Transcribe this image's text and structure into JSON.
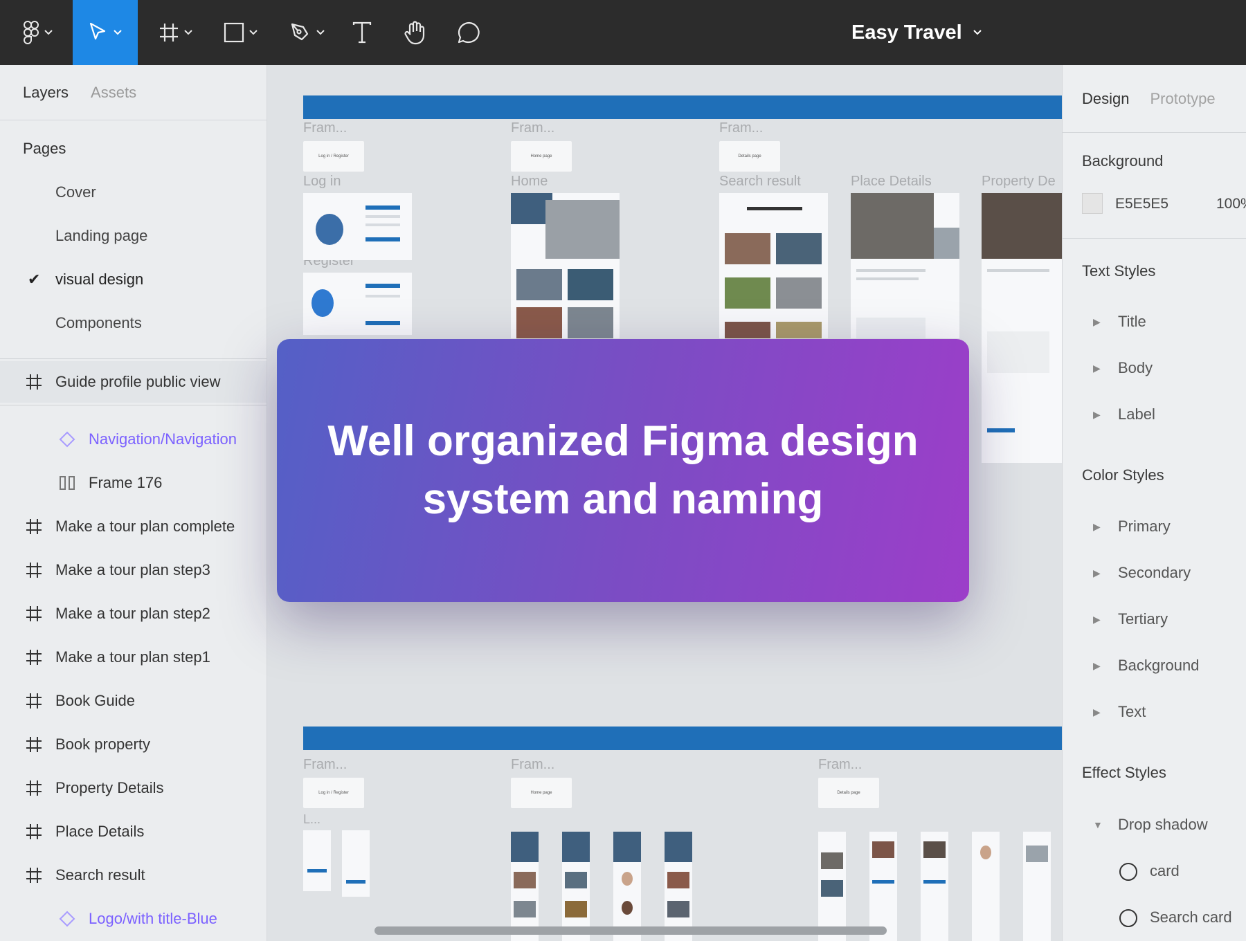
{
  "toolbar": {
    "file_title": "Easy Travel"
  },
  "left_panel": {
    "tabs": [
      "Layers",
      "Assets"
    ],
    "pages_heading": "Pages",
    "pages": [
      "Cover",
      "Landing page",
      "visual design",
      "Components"
    ],
    "selected_page": "visual design",
    "layers": [
      {
        "name": "Guide profile public view",
        "kind": "frame-top"
      },
      {
        "name": "Navigation/Navigation",
        "kind": "component"
      },
      {
        "name": "Frame 176",
        "kind": "frame-child"
      },
      {
        "name": "Make a tour plan complete",
        "kind": "frame"
      },
      {
        "name": "Make a tour plan step3",
        "kind": "frame"
      },
      {
        "name": "Make a tour plan step2",
        "kind": "frame"
      },
      {
        "name": "Make a tour plan step1",
        "kind": "frame"
      },
      {
        "name": "Book Guide",
        "kind": "frame"
      },
      {
        "name": "Book property",
        "kind": "frame"
      },
      {
        "name": "Property Details",
        "kind": "frame"
      },
      {
        "name": "Place Details",
        "kind": "frame"
      },
      {
        "name": "Search result",
        "kind": "frame"
      },
      {
        "name": "Logo/with title-Blue",
        "kind": "component"
      }
    ]
  },
  "right_panel": {
    "tabs": [
      "Design",
      "Prototype"
    ],
    "background_heading": "Background",
    "background_hex": "E5E5E5",
    "background_opacity": "100%",
    "text_styles_heading": "Text Styles",
    "text_styles": [
      "Title",
      "Body",
      "Label"
    ],
    "color_styles_heading": "Color Styles",
    "color_styles": [
      "Primary",
      "Secondary",
      "Tertiary",
      "Background",
      "Text"
    ],
    "effect_styles_heading": "Effect Styles",
    "effect_group": "Drop shadow",
    "effects": [
      "card",
      "Search card"
    ]
  },
  "canvas": {
    "frame_labels_top": [
      "Fram...",
      "Fram...",
      "Fram..."
    ],
    "chip_labels_top": [
      "Log in / Register",
      "Home page",
      "Details page"
    ],
    "screen_labels": [
      "Log in",
      "Register",
      "Home",
      "Search result",
      "Place Details",
      "Property De"
    ],
    "frame_labels_bottom": [
      "Fram...",
      "Fram...",
      "Fram..."
    ],
    "chip_labels_bottom": [
      "Log in / Register",
      "Home page",
      "Details page"
    ],
    "bottom_small_label": "L..."
  },
  "banner": {
    "text": "Well organized Figma design system and naming"
  },
  "colors": {
    "toolbar_bg": "#2c2c2c",
    "active_tool": "#1e88e5",
    "section_bar": "#1f6fb8",
    "component_text": "#7b61ff"
  }
}
